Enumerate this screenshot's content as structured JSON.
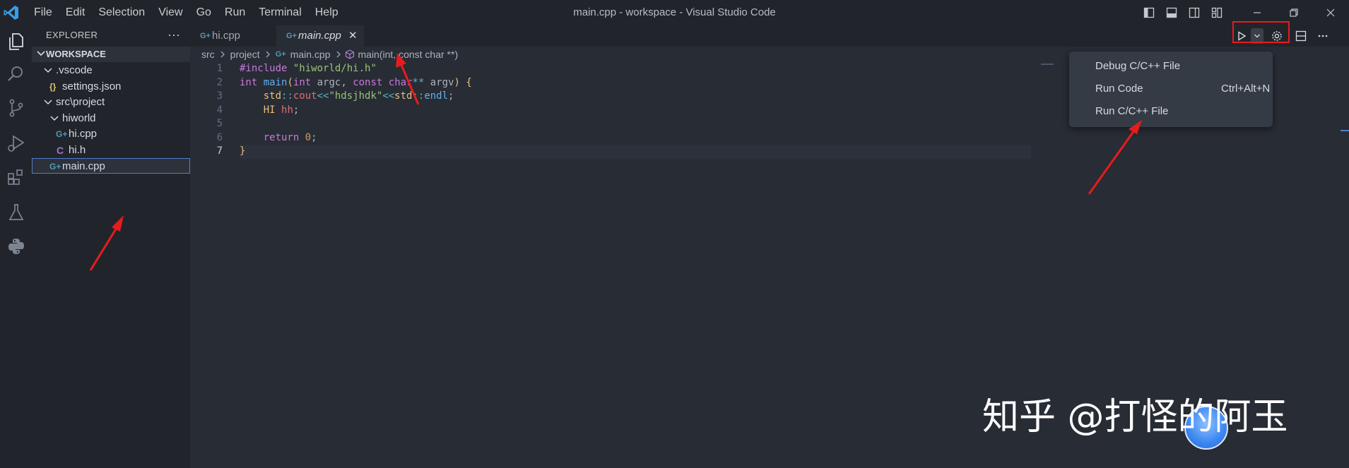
{
  "window": {
    "title": "main.cpp - workspace - Visual Studio Code"
  },
  "menubar": {
    "items": [
      "File",
      "Edit",
      "Selection",
      "View",
      "Go",
      "Run",
      "Terminal",
      "Help"
    ]
  },
  "sidebar": {
    "title": "EXPLORER",
    "more": "···",
    "workspace": "WORKSPACE",
    "tree": [
      {
        "name": ".vscode",
        "kind": "folder"
      },
      {
        "name": "settings.json",
        "kind": "json",
        "icon": "{}"
      },
      {
        "name": "src\\project",
        "kind": "folder"
      },
      {
        "name": "hiworld",
        "kind": "folder"
      },
      {
        "name": "hi.cpp",
        "kind": "cpp",
        "icon": "G+"
      },
      {
        "name": "hi.h",
        "kind": "h",
        "icon": "C"
      },
      {
        "name": "main.cpp",
        "kind": "cpp",
        "icon": "G+",
        "selected": true
      }
    ]
  },
  "tabs": [
    {
      "label": "hi.cpp",
      "icon": "G+",
      "active": false
    },
    {
      "label": "main.cpp",
      "icon": "G+",
      "active": true,
      "close": "✕"
    }
  ],
  "breadcrumb": {
    "items": [
      "src",
      "project",
      "main.cpp",
      "main(int, const char **)"
    ],
    "file_icon": "G+"
  },
  "editor": {
    "line_numbers": [
      "1",
      "2",
      "3",
      "4",
      "5",
      "6",
      "7"
    ],
    "current_line": 7
  },
  "run_menu": {
    "items": [
      {
        "label": "Debug C/C++ File",
        "shortcut": ""
      },
      {
        "label": "Run Code",
        "shortcut": "Ctrl+Alt+N"
      },
      {
        "label": "Run C/C++ File",
        "shortcut": ""
      }
    ]
  },
  "watermark": {
    "text": "知乎 @打怪的阿玉"
  },
  "colors": {
    "accent_blue": "#4f7fce",
    "annotation_red": "#e61c1c",
    "editor_bg": "#282c34",
    "sidebar_bg": "#21252b"
  }
}
